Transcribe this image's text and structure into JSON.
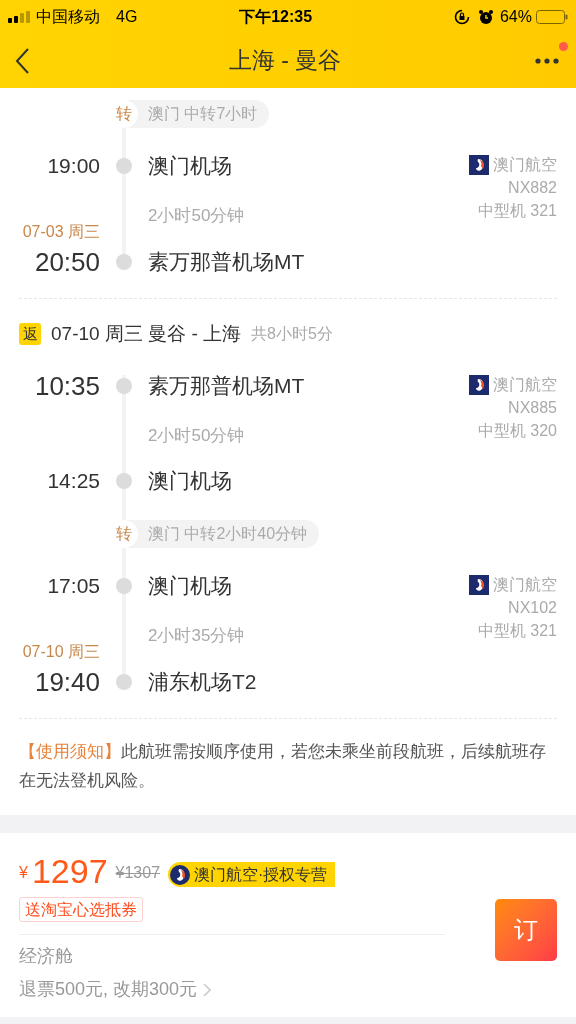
{
  "status_bar": {
    "carrier": "中国移动",
    "network": "4G",
    "time": "下午12:35",
    "battery": "64%"
  },
  "nav": {
    "title": "上海 - 曼谷",
    "has_badge": true
  },
  "outbound": [
    {
      "kind": "transfer",
      "tag": "转",
      "text": "澳门 中转7小时"
    },
    {
      "kind": "leg",
      "depart": {
        "time": "19:00",
        "airport": "澳门机场",
        "emphasis": false
      },
      "duration": "2小时50分钟",
      "arrive": {
        "date": "07-03 周三",
        "time": "20:50",
        "airport": "素万那普机场MT",
        "emphasis": true
      },
      "airline": {
        "name": "澳门航空",
        "flight": "NX882",
        "aircraft": "中型机 321"
      }
    }
  ],
  "return": {
    "tag": "返",
    "title": "07-10 周三 曼谷 - 上海",
    "total": "共8小时5分",
    "items": [
      {
        "kind": "leg",
        "depart": {
          "time": "10:35",
          "airport": "素万那普机场MT",
          "emphasis": true
        },
        "duration": "2小时50分钟",
        "arrive": {
          "time": "14:25",
          "airport": "澳门机场",
          "emphasis": false
        },
        "airline": {
          "name": "澳门航空",
          "flight": "NX885",
          "aircraft": "中型机 320"
        }
      },
      {
        "kind": "transfer",
        "tag": "转",
        "text": "澳门 中转2小时40分钟"
      },
      {
        "kind": "leg",
        "depart": {
          "time": "17:05",
          "airport": "澳门机场",
          "emphasis": false
        },
        "duration": "2小时35分钟",
        "arrive": {
          "date": "07-10 周三",
          "time": "19:40",
          "airport": "浦东机场T2",
          "emphasis": true
        },
        "airline": {
          "name": "澳门航空",
          "flight": "NX102",
          "aircraft": "中型机 321"
        }
      }
    ]
  },
  "notice": {
    "label": "【使用须知】",
    "text": "此航班需按顺序使用，若您未乘坐前段航班，后续航班存在无法登机风险。"
  },
  "offer": {
    "currency": "¥",
    "price": "1297",
    "original_price": "¥1307",
    "badge": "澳门航空·授权专营",
    "coupon": "送淘宝心选抵券",
    "cabin": "经济舱",
    "rules": "退票500元, 改期300元",
    "book": "订"
  }
}
